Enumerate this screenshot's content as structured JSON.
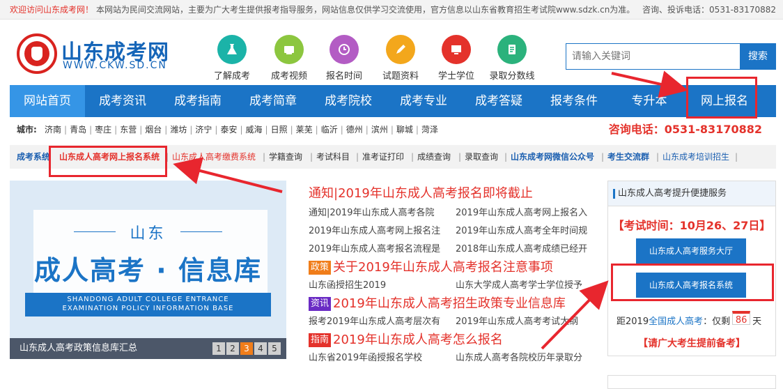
{
  "topbar": {
    "welcome": "欢迎访问山东成考网！",
    "notice": "本网站为民间交流网站，主要为广大考生提供报考指导服务，网站信息仅供学习交流使用，官方信息以山东省教育招生考试院www.sdzk.cn为准。",
    "contact": "咨询、投诉电话：0531-83170882"
  },
  "logo": {
    "name": "山东成考网",
    "url": "WWW.CKW.SD.CN"
  },
  "quick_links": [
    {
      "label": "了解成考",
      "color": "#1bb3a8",
      "icon": "flask-icon"
    },
    {
      "label": "成考视频",
      "color": "#8cc63f",
      "icon": "video-icon"
    },
    {
      "label": "报名时间",
      "color": "#b35cc4",
      "icon": "clock-icon"
    },
    {
      "label": "试题资料",
      "color": "#f3a71c",
      "icon": "pen-icon"
    },
    {
      "label": "学士学位",
      "color": "#e4322b",
      "icon": "degree-icon"
    },
    {
      "label": "录取分数线",
      "color": "#2bb27c",
      "icon": "list-icon"
    }
  ],
  "search": {
    "placeholder": "请输入关键词",
    "button": "搜索"
  },
  "nav": [
    "网站首页",
    "成考资讯",
    "成考指南",
    "成考简章",
    "成考院校",
    "成考专业",
    "成考答疑",
    "报考条件",
    "专升本",
    "网上报名"
  ],
  "cities": {
    "lead": "城市:",
    "list": [
      "济南",
      "青岛",
      "枣庄",
      "东营",
      "烟台",
      "潍坊",
      "济宁",
      "泰安",
      "威海",
      "日照",
      "莱芜",
      "临沂",
      "德州",
      "滨州",
      "聊城",
      "菏泽"
    ],
    "hotline": "咨询电话：0531-83170882"
  },
  "sysbar": {
    "lead": "成考系统",
    "items": [
      {
        "text": "山东成人高考网上报名系统",
        "color": "#e4322b",
        "bold": true
      },
      {
        "text": "山东成人高考缴费系统",
        "color": "#e4322b",
        "bold": false
      },
      {
        "text": "学籍查询",
        "color": "#333333",
        "bold": false
      },
      {
        "text": "考试科目",
        "color": "#333333",
        "bold": false
      },
      {
        "text": "准考证打印",
        "color": "#333333",
        "bold": false
      },
      {
        "text": "成绩查询",
        "color": "#333333",
        "bold": false
      },
      {
        "text": "录取查询",
        "color": "#333333",
        "bold": false
      },
      {
        "text": "山东成考网微信公众号",
        "color": "#1b5fb0",
        "bold": true
      },
      {
        "text": "考生交流群",
        "color": "#1b5fb0",
        "bold": true
      },
      {
        "text": "山东成考培训招生",
        "color": "#1b5fb0",
        "bold": false
      }
    ]
  },
  "banner": {
    "line1": "山东",
    "line2": "成人高考 · 信息库",
    "line3a": "SHANDONG ADULT COLLEGE ENTRANCE",
    "line3b": "EXAMINATION POLICY INFORMATION BASE",
    "caption": "山东成人高考政策信息库汇总",
    "pages": [
      "1",
      "2",
      "3",
      "4",
      "5"
    ],
    "active_page": "3"
  },
  "news": {
    "headline": "通知|2019年山东成人高考报名即将截止",
    "rows1": [
      [
        "通知|2019年山东成人高考各院",
        "2019年山东成人高考网上报名入"
      ],
      [
        "2019年山东成人高考网上报名注",
        "2019年山东成人高考全年时间规"
      ],
      [
        "2019年山东成人高考报名流程是",
        "2018年山东成人高考成绩已经开"
      ]
    ],
    "block2": {
      "tag": "政策",
      "tag_color": "#f07d1a",
      "head": "关于2019年山东成人高考报名注意事项",
      "row": [
        "山东函授招生2019",
        "山东大学成人高考学士学位授予"
      ]
    },
    "block3": {
      "tag": "资讯",
      "tag_color": "#6a2bc4",
      "head": "2019年山东成人高考招生政策专业信息库",
      "row": [
        "报考2019年山东成人高考层次有",
        "2019年山东成人高考考试大纲"
      ]
    },
    "block4": {
      "tag": "指南",
      "tag_color": "#e4322b",
      "head": "2019年山东成人高考怎么报名",
      "row": [
        "山东省2019年函授报名学校",
        "山东成人高考各院校历年录取分"
      ]
    }
  },
  "service": {
    "title": "山东成人高考提升便捷服务",
    "date": "【考试时间：10月26、27日】",
    "btn1": "山东成人高考服务大厅",
    "btn2": "山东成人高考报名系统",
    "countdown_pre": "距2019",
    "countdown_blue": "全国成人高考",
    "countdown_mid": "：仅剩",
    "countdown_num": "86",
    "countdown_post": "天",
    "remind": "【请广大考生提前备考】"
  },
  "colors": {
    "primary": "#1b74c6",
    "accent": "#e4322b",
    "annotation": "#e8262e"
  }
}
